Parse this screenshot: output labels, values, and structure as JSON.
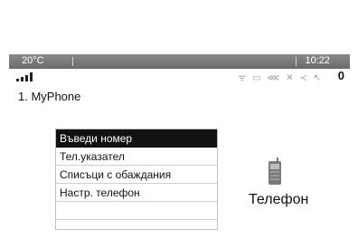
{
  "status_bar": {
    "temperature": "20°C",
    "time": "10:22"
  },
  "indicators": {
    "signal_icon": "signal-bars-icon",
    "status_icons": [
      "wifi-icon",
      "sms-icon",
      "bluetooth-icon",
      "mute-icon",
      "voice-icon",
      "call-icon"
    ],
    "status_glyphs": "ᯤ ▭ ⋘ ✕ ≺ ↖",
    "count": "0"
  },
  "device": {
    "name": "1. MyPhone"
  },
  "menu": {
    "items": [
      {
        "label": "Въведи номер",
        "selected": true
      },
      {
        "label": "Тел.указател",
        "selected": false
      },
      {
        "label": "Списъци с обаждания",
        "selected": false
      },
      {
        "label": "Настр. телефон",
        "selected": false
      },
      {
        "label": "",
        "selected": false
      }
    ]
  },
  "app": {
    "icon": "mobile-phone-icon",
    "label": "Телефон"
  }
}
